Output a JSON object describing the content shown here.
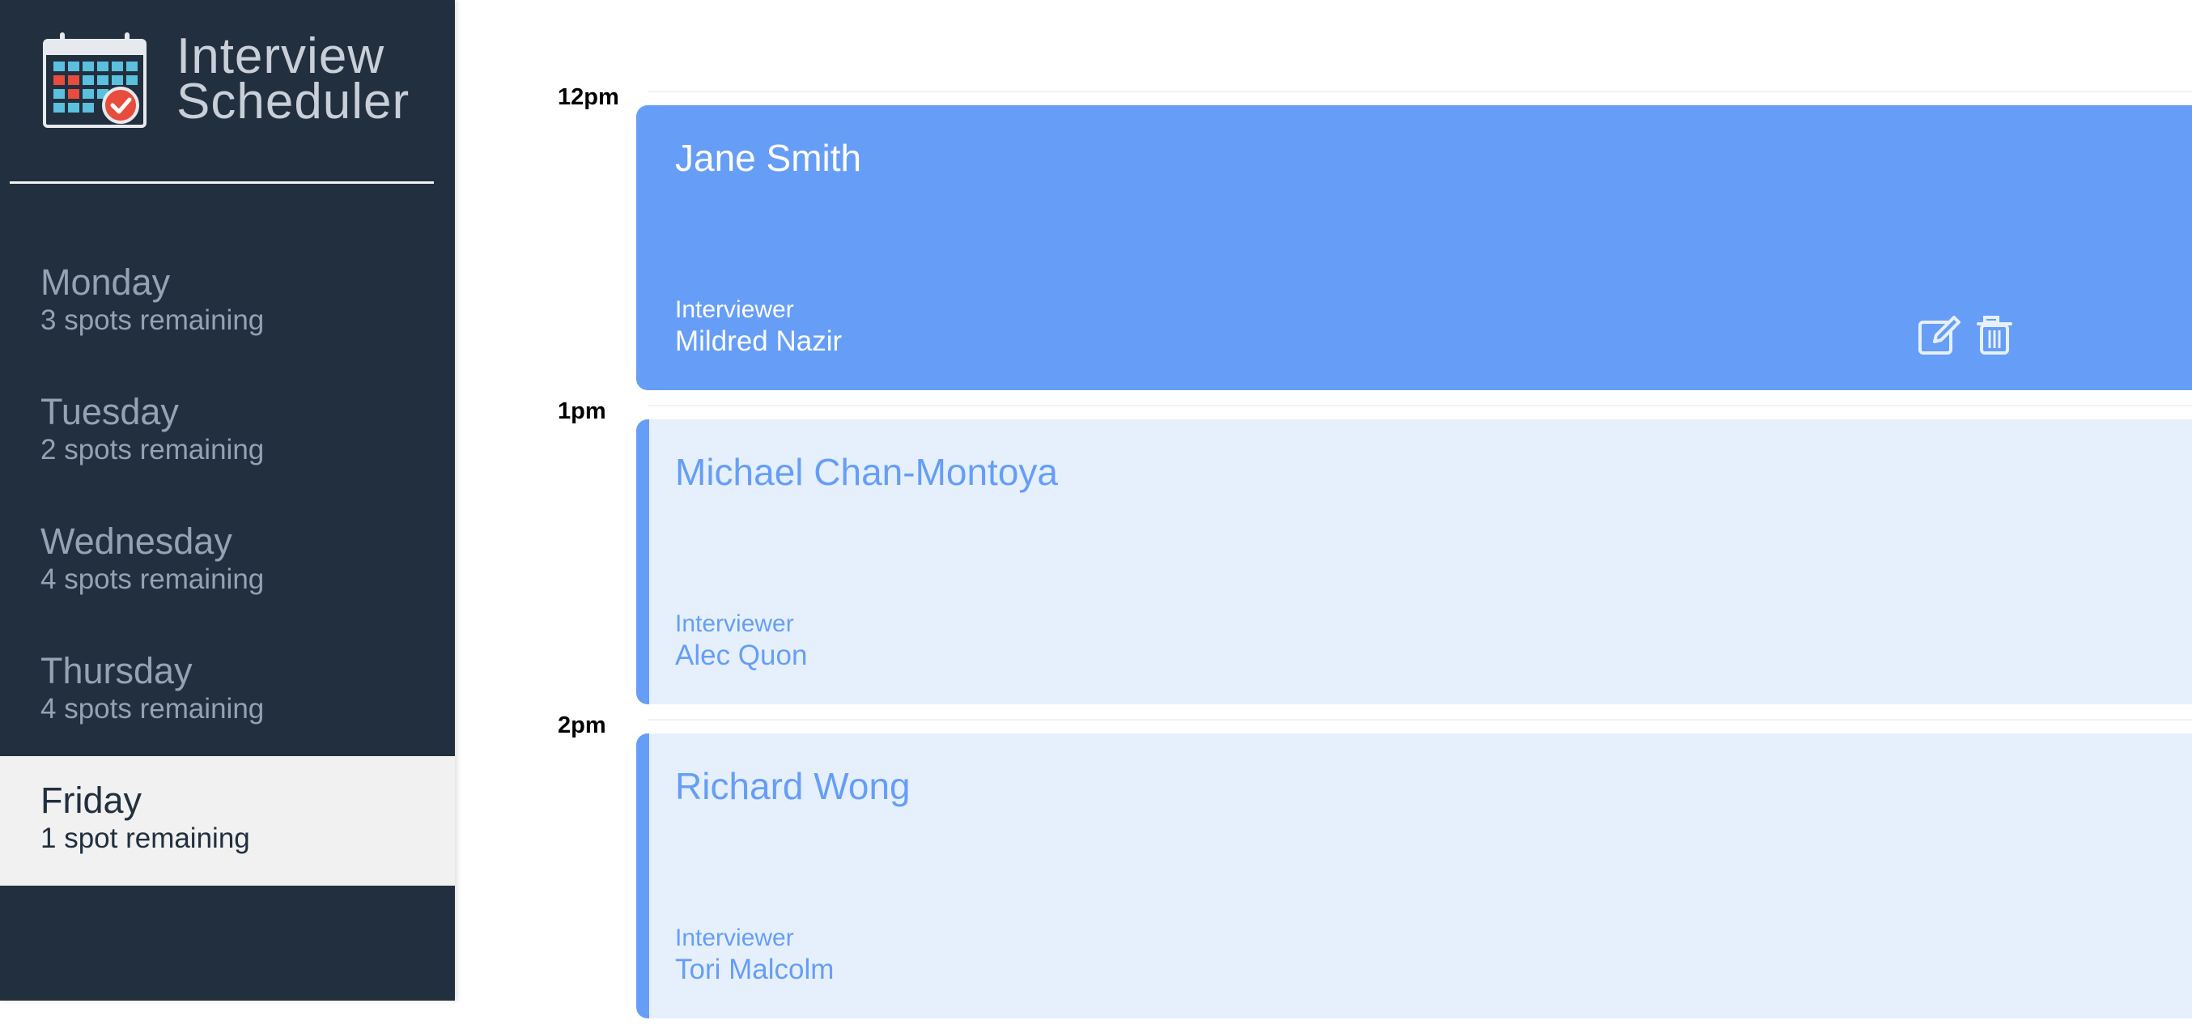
{
  "app": {
    "title_line1": "Interview",
    "title_line2": "Scheduler"
  },
  "colors": {
    "sidebar": "#222f3e",
    "accent": "#669ef7",
    "card_light": "#e6f0fd",
    "selected_day": "#f1f1f1"
  },
  "days": [
    {
      "name": "Monday",
      "spots": "3 spots remaining",
      "selected": false
    },
    {
      "name": "Tuesday",
      "spots": "2 spots remaining",
      "selected": false
    },
    {
      "name": "Wednesday",
      "spots": "4 spots remaining",
      "selected": false
    },
    {
      "name": "Thursday",
      "spots": "4 spots remaining",
      "selected": false
    },
    {
      "name": "Friday",
      "spots": "1 spot remaining",
      "selected": true
    }
  ],
  "appointments": [
    {
      "time": "12pm",
      "student": "Jane Smith",
      "interviewer_label": "Interviewer",
      "interviewer": "Mildred Nazir",
      "active": true,
      "icons": [
        "edit-icon",
        "trash-icon"
      ]
    },
    {
      "time": "1pm",
      "student": "Michael Chan-Montoya",
      "interviewer_label": "Interviewer",
      "interviewer": "Alec Quon",
      "active": false
    },
    {
      "time": "2pm",
      "student": "Richard Wong",
      "interviewer_label": "Interviewer",
      "interviewer": "Tori Malcolm",
      "active": false
    }
  ]
}
